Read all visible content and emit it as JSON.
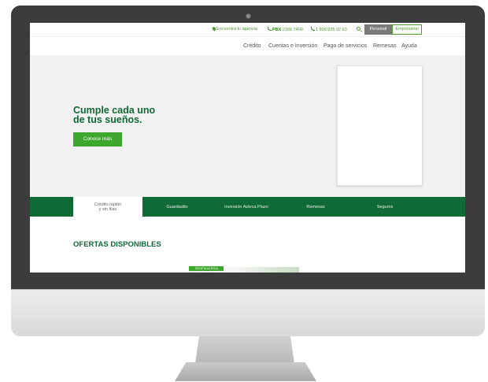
{
  "topbar": {
    "agency_link": "Encuentra tu agencia",
    "pbx_label": "PBX",
    "pbx_number": "2306 7400",
    "toll_free": "1 800 835 02 63",
    "segment_personal": "Personal",
    "segment_empresarial": "Empresarial"
  },
  "nav": {
    "items": [
      "Crédito",
      "Cuentas e Inversión",
      "Pago de servicios",
      "Remesas",
      "Ayuda"
    ]
  },
  "hero": {
    "title_line1": "Cumple cada uno",
    "title_line2": "de tus sueños.",
    "cta": "Conoce más"
  },
  "tabs": {
    "items": [
      {
        "line1": "Crédito rápido",
        "line2": "y sin filas"
      },
      {
        "line1": "Guardadito",
        "line2": ""
      },
      {
        "line1": "Inversión Azteca Plazo",
        "line2": ""
      },
      {
        "line1": "Remesas",
        "line2": ""
      },
      {
        "line1": "Seguros",
        "line2": ""
      }
    ],
    "active_index": 0
  },
  "offers": {
    "title": "OFERTAS DISPONIBLES",
    "card_badge": "TARJETA AZTECA"
  },
  "colors": {
    "brand_dark_green": "#0f6a36",
    "brand_green": "#3da82d",
    "link_green": "#4a9a2c"
  },
  "icons": {
    "agency": "location-pin-icon",
    "phone": "phone-icon",
    "search": "search-icon"
  }
}
